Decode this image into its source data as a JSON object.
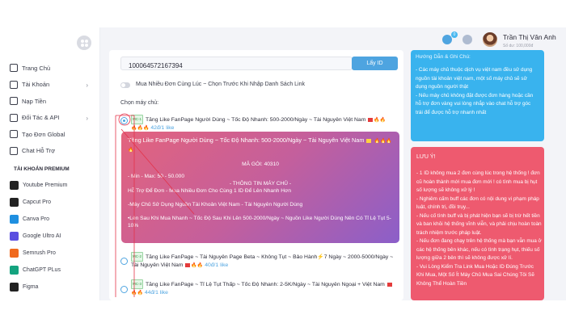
{
  "user": {
    "name": "Trần Thị Vân Anh",
    "balance": "Số dư: 100,000đ",
    "notification_count": "0"
  },
  "sidebar": {
    "items": [
      {
        "label": "Trang Chủ",
        "icon": "home-icon",
        "has_children": false
      },
      {
        "label": "Tài Khoản",
        "icon": "user-icon",
        "has_children": true
      },
      {
        "label": "Nạp Tiền",
        "icon": "card-icon",
        "has_children": false
      },
      {
        "label": "Đối Tác & API",
        "icon": "api-icon",
        "has_children": true
      },
      {
        "label": "Tạo Đơn Global",
        "icon": "globe-icon",
        "has_children": false
      },
      {
        "label": "Chat Hỗ Trợ",
        "icon": "chat-icon",
        "has_children": false
      }
    ],
    "section_title": "TÀI KHOẢN PREMIUM",
    "premium": [
      {
        "label": "Youtube Premium",
        "color": "#222222"
      },
      {
        "label": "Capcut Pro",
        "color": "#222222"
      },
      {
        "label": "Canva Pro",
        "color": "#1f8fe0"
      },
      {
        "label": "Google Ultro AI",
        "color": "#5a4ee0"
      },
      {
        "label": "Semrush Pro",
        "color": "#f06a1e"
      },
      {
        "label": "ChatGPT PLus",
        "color": "#14a37f"
      },
      {
        "label": "Figma",
        "color": "#222222"
      }
    ]
  },
  "form": {
    "link_value": "100064572167394",
    "get_id_label": "Lấy ID",
    "toggle_label": "Mua Nhiều Đơn Cùng Lúc ~ Chọn Trước Khi Nhập Danh Sách Link",
    "choose_server_label": "Chọn máy chủ:"
  },
  "servers": [
    {
      "tag": "MC-1",
      "title": "Tăng Like FanPage Người Dùng ~ Tốc Độ Nhanh: 500-2000/Ngày ~ Tài Nguyên Việt Nam",
      "price": "42đ/1 like",
      "checked": true
    },
    {
      "tag": "MC-2",
      "title": "Tăng Like FanPage ~ Tài Nguyên Page Beta ~ Không Tụt ~ Bảo Hành⚡7 Ngày ~ 2000-5000/Ngày ~ Tài Nguyên Việt Nam",
      "price": "40đ/1 like",
      "checked": false
    },
    {
      "tag": "MC-3",
      "title": "Tăng Like FanPage ~ Tỉ Lệ Tụt Thấp ~ Tốc Độ Nhanh: 2-5K/Ngày ~ Tài Nguyên Ngoại + Việt Nam",
      "price": "44đ/1 like",
      "checked": false
    }
  ],
  "detail": {
    "title": "Tăng Like FanPage Người Dùng ~ Tốc Độ Nhanh: 500-2000/Ngày ~ Tài Nguyên Việt Nam",
    "package": "MÃ GÓI: 40310",
    "min_max": "- Min - Max: 50 - 50.000",
    "info_header": "- THÔNG TIN MÁY CHỦ -",
    "line1": "Hỗ Trợ Để Đơn - Mua Nhiều Đơn Cho Cùng 1 ID Để Lên Nhanh Hơn",
    "line2": "-Máy Chủ Sử Dụng Nguồn Tài Khoản Việt Nam - Tài Nguyên Người Dùng",
    "line3": "•Lên Sau Khi Mua Nhanh ~ Tốc Độ Sau Khi Lên 500-2000/Ngày ~ Nguồn Like Người Dùng Nên Có Tỉ Lệ Tụt 5-10%"
  },
  "guide": {
    "title": "Hướng Dẫn & Ghi Chú:",
    "body": "- Các máy chủ thuộc dịch vụ việt nam đều sử dụng nguồn tài khoản việt nam, một số máy chủ sẽ sử dụng nguồn người thật\n- Nếu máy chủ không đặt được đơn hàng hoặc cần hỗ trợ đơn vàng vui lòng nhắp vào chat hỗ trợ góc trái để được hỗ trợ nhanh nhất"
  },
  "warning": {
    "title": "LƯU Ý!",
    "body": "- 1 ID không mua 2 đơn cùng lúc trong hệ thống ! đơn cũ hoàn thành mới mua đơn mới ! có tình mua bị hụt số lượng sẽ không xử lý !\n- Nghiêm cấm buff các đơn có nội dung vi phạm pháp luật, chính trị, đồi trụy...\n- Nếu cố tình buff và bị phát hiện bạn sẽ bị trừ hết tiền và ban khỏi hệ thống vĩnh viễn, và phải chịu hoàn toàn trách nhiệm trước pháp luật.\n- Nếu đơn đang chạy trên hệ thống mà bạn vẫn mua ở các hệ thống bên khác, nếu có tình trạng hụt, thiếu số lượng giữa 2 bên thì sẽ không được xử lí.\n- Vui Lòng Kiểm Tra Link Mua Hoặc ID Đúng Trước Khi Mua, Một Số Ít Máy Chủ Mua Sai Chúng Tôi Sẽ Không Thể Hoàn Tiền"
  }
}
